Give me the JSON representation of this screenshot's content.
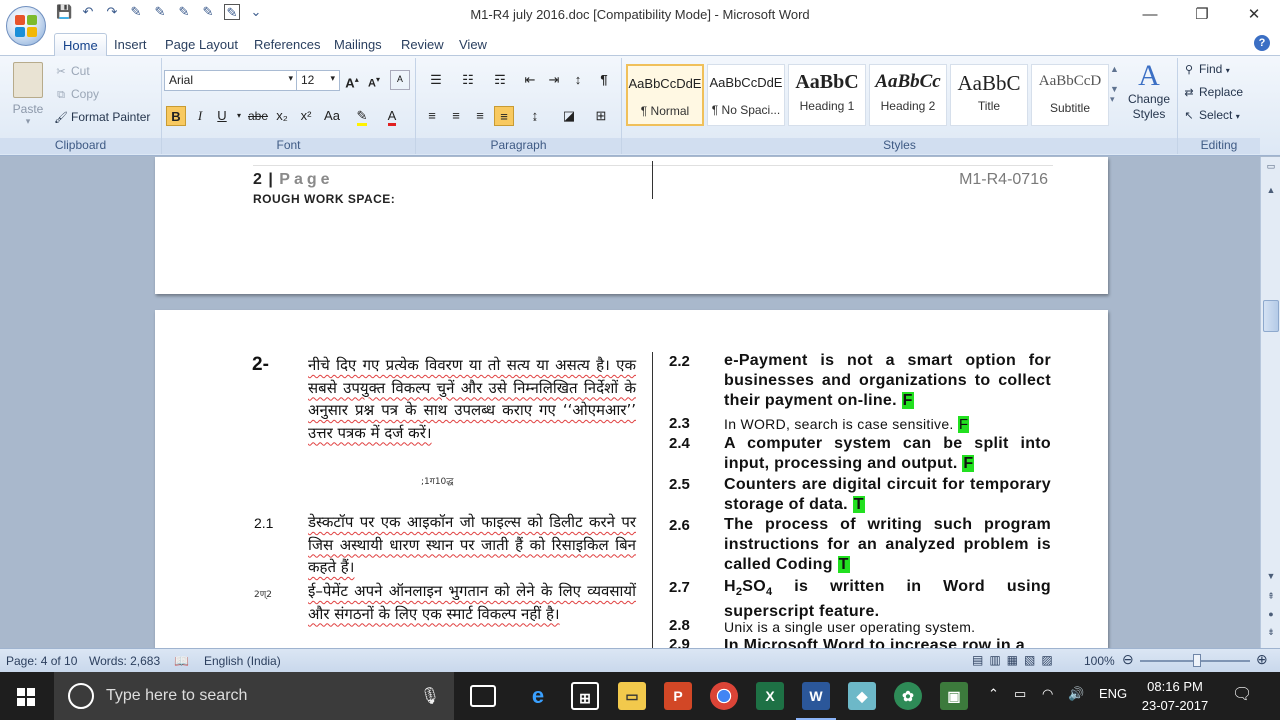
{
  "window": {
    "title": "M1-R4 july 2016.doc [Compatibility Mode] - Microsoft Word",
    "minimize": "—",
    "restore": "❐",
    "close": "✕"
  },
  "tabs": [
    "Home",
    "Insert",
    "Page Layout",
    "References",
    "Mailings",
    "Review",
    "View"
  ],
  "clipboard": {
    "paste": "Paste",
    "cut": "Cut",
    "copy": "Copy",
    "format_painter": "Format Painter",
    "label": "Clipboard"
  },
  "font": {
    "name": "Arial",
    "size": "12",
    "label": "Font",
    "bold": "B",
    "italic": "I",
    "underline": "U",
    "strike": "abe",
    "subscript": "x₂",
    "superscript": "x²",
    "change_case": "Aa"
  },
  "paragraph": {
    "label": "Paragraph"
  },
  "styles": {
    "label": "Styles",
    "items": [
      {
        "sample": "AaBbCcDdE",
        "name": "¶ Normal"
      },
      {
        "sample": "AaBbCcDdE",
        "name": "¶ No Spaci..."
      },
      {
        "sample": "AaBbC",
        "name": "Heading 1"
      },
      {
        "sample": "AaBbCc",
        "name": "Heading 2"
      },
      {
        "sample": "AaBbC",
        "name": "Title"
      },
      {
        "sample": "AaBbCcD",
        "name": "Subtitle"
      }
    ],
    "change_styles": "Change Styles"
  },
  "editing": {
    "label": "Editing",
    "find": "Find",
    "replace": "Replace",
    "select": "Select"
  },
  "page1": {
    "page_num": "2",
    "page_word": "Page",
    "code": "M1-R4-0716",
    "rough": "ROUGH WORK SPACE:"
  },
  "page2": {
    "q2_num": "2-",
    "q2_text": "नीचे दिए गए प्रत्येक विवरण या तो सत्य या असत्य है। एक सबसे उपयुक्त विकल्प चुनें और उसे निम्नलिखित निर्देशों के अनुसार प्रश्न पत्र के साथ उपलब्ध कराए गए ‘‘ओएमआर’’ उत्तर पत्रक में दर्ज करें।",
    "q2_mark": ";1ग10द्ध",
    "q21_num": "2.1",
    "q21_text": "डेस्कटॉप पर एक आइकॉन जो फाइल्स को डिलीट करने पर जिस अस्थायी धारण स्थान पर जाती हैं को रिसाइकिल बिन कहते हैं।",
    "q22h_num": "2ण्2",
    "q22h_text": "ई–पेमेंट अपने ऑनलाइन भुगतान को लेने के लिए व्यवसायों और संगठनों के लिए एक स्मार्ट विकल्प नहीं है।",
    "right": [
      {
        "num": "2.2",
        "text": "e-Payment is not a smart option for businesses and organizations to collect their payment on-line.",
        "ans": "F"
      },
      {
        "num": "2.3",
        "text": "In WORD, search is case sensitive.",
        "ans": "F"
      },
      {
        "num": "2.4",
        "text": "A computer system can be split into input, processing and output.",
        "ans": "F"
      },
      {
        "num": "2.5",
        "text": "Counters are digital circuit for temporary storage of data.",
        "ans": "T"
      },
      {
        "num": "2.6",
        "text": "The process of writing such program instructions for an analyzed problem is called Coding",
        "ans": "T"
      },
      {
        "num": "2.7",
        "text_a": "H",
        "sub1": "2",
        "text_b": "SO",
        "sub2": "4",
        "text_c": " is written in Word using superscript feature."
      },
      {
        "num": "2.8",
        "text": "Unix is a single user operating system."
      },
      {
        "num": "2.9",
        "text": "In Microsoft Word to increase row in a"
      }
    ]
  },
  "status": {
    "page": "Page: 4 of 10",
    "words": "Words: 2,683",
    "language": "English (India)",
    "zoom": "100%"
  },
  "taskbar": {
    "search_placeholder": "Type here to search",
    "lang": "ENG",
    "time": "08:16 PM",
    "date": "23-07-2017"
  }
}
